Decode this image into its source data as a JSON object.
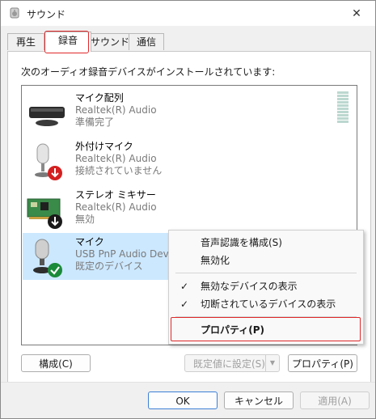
{
  "window": {
    "title": "サウンド",
    "close_glyph": "✕"
  },
  "tabs": [
    {
      "label": "再生"
    },
    {
      "label": "録音"
    },
    {
      "label": "サウンド"
    },
    {
      "label": "通信"
    }
  ],
  "instruction": "次のオーディオ録音デバイスがインストールされています:",
  "devices": [
    {
      "name": "マイク配列",
      "driver": "Realtek(R) Audio",
      "status": "準備完了"
    },
    {
      "name": "外付けマイク",
      "driver": "Realtek(R) Audio",
      "status": "接続されていません"
    },
    {
      "name": "ステレオ ミキサー",
      "driver": "Realtek(R) Audio",
      "status": "無効"
    },
    {
      "name": "マイク",
      "driver": "USB PnP Audio Device",
      "status": "既定のデバイス"
    }
  ],
  "context_menu": {
    "items": [
      {
        "label": "音声認識を構成(S)"
      },
      {
        "label": "無効化"
      },
      {
        "label": "無効なデバイスの表示",
        "checked": "✓"
      },
      {
        "label": "切断されているデバイスの表示",
        "checked": "✓"
      },
      {
        "label": "プロパティ(P)"
      }
    ]
  },
  "buttons": {
    "configure": "構成(C)",
    "set_default": "既定値に設定(S)",
    "properties": "プロパティ(P)",
    "ok": "OK",
    "cancel": "キャンセル",
    "apply": "適用(A)"
  },
  "colors": {
    "selection": "#cce8ff",
    "highlight_border": "#e0282a",
    "default_button_border": "#3c7fd6"
  }
}
